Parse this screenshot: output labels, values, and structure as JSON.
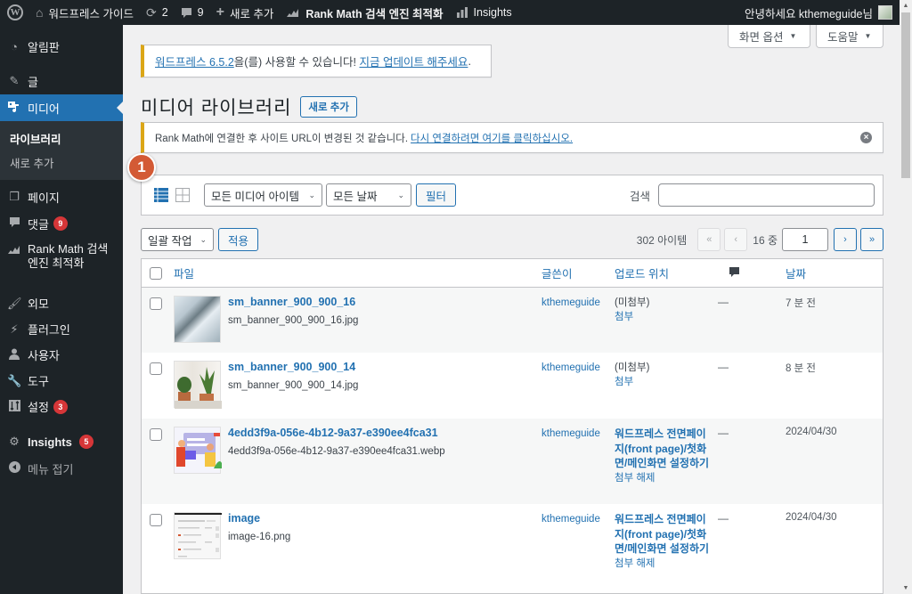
{
  "admin_bar": {
    "wp_logo": "W",
    "site_name": "워드프레스 가이드",
    "updates_count": "2",
    "comments_count": "9",
    "new_label": "새로 추가",
    "rankmath_label": "Rank Math 검색 엔진 최적화",
    "insights_label": "Insights",
    "greeting": "안녕하세요 kthemeguide님"
  },
  "sidebar": {
    "items": [
      {
        "label": "알림판",
        "icon": "dashboard-icon"
      },
      {
        "label": "글",
        "icon": "pin-icon"
      },
      {
        "label": "미디어",
        "icon": "media-icon",
        "current": true
      },
      {
        "label": "페이지",
        "icon": "pages-icon"
      },
      {
        "label": "댓글",
        "icon": "comments-icon",
        "badge": "9"
      },
      {
        "label": "Rank Math 검색 엔진 최적화",
        "label_line1": "Rank Math 검색",
        "label_line2": "엔진 최적화",
        "icon": "rankmath-icon"
      },
      {
        "label": "외모",
        "icon": "appearance-icon"
      },
      {
        "label": "플러그인",
        "icon": "plugins-icon"
      },
      {
        "label": "사용자",
        "icon": "users-icon"
      },
      {
        "label": "도구",
        "icon": "tools-icon"
      },
      {
        "label": "설정",
        "icon": "settings-icon",
        "badge": "3"
      },
      {
        "label": "Insights",
        "icon": "insights-icon",
        "badge": "5"
      },
      {
        "label": "메뉴 접기",
        "icon": "collapse-icon"
      }
    ],
    "submenu": {
      "library": "라이브러리",
      "add_new": "새로 추가"
    }
  },
  "screen_meta": {
    "screen_options": "화면 옵션",
    "help": "도움말"
  },
  "update_notice": {
    "link1": "워드프레스 6.5.2",
    "text": "을(를) 사용할 수 있습니다! ",
    "link2": "지금 업데이트 해주세요",
    "end": "."
  },
  "page": {
    "title": "미디어 라이브러리",
    "add_new": "새로 추가"
  },
  "rankmath_notice": {
    "text": "Rank Math에 연결한 후 사이트 URL이 변경된 것 같습니다.",
    "link": "다시 연결하려면 여기를 클릭하십시오."
  },
  "annotation": {
    "step": "1"
  },
  "filter_bar": {
    "media_type": "모든 미디어 아이템",
    "date": "모든 날짜",
    "filter_button": "필터",
    "search_label": "검색",
    "search_value": ""
  },
  "tablenav": {
    "bulk_action": "일괄 작업",
    "apply": "적용",
    "item_count": "302 아이템",
    "first": "«",
    "prev": "‹",
    "total_pages_label": "16 중",
    "current_page": "1",
    "next": "›",
    "last": "»"
  },
  "table": {
    "columns": {
      "file": "파일",
      "author": "글쓴이",
      "uploaded_to": "업로드 위치",
      "comments_icon": "comment-icon",
      "date": "날짜"
    },
    "rows": [
      {
        "title": "sm_banner_900_900_16",
        "filename": "sm_banner_900_900_16.jpg",
        "author": "kthemeguide",
        "parent": "(미첨부)",
        "parent_action": "첨부",
        "comments": "—",
        "date": "7 분 전"
      },
      {
        "title": "sm_banner_900_900_14",
        "filename": "sm_banner_900_900_14.jpg",
        "author": "kthemeguide",
        "parent": "(미첨부)",
        "parent_action": "첨부",
        "comments": "—",
        "date": "8 분 전"
      },
      {
        "title": "4edd3f9a-056e-4b12-9a37-e390ee4fca31",
        "filename": "4edd3f9a-056e-4b12-9a37-e390ee4fca31.webp",
        "author": "kthemeguide",
        "parent": "워드프레스 전면페이지(front page)/첫화면/메인화면 설정하기",
        "parent_action": "첨부 해제",
        "comments": "—",
        "date": "2024/04/30"
      },
      {
        "title": "image",
        "filename": "image-16.png",
        "author": "kthemeguide",
        "parent": "워드프레스 전면페이지(front page)/첫화면/메인화면 설정하기",
        "parent_action": "첨부 해제",
        "comments": "—",
        "date": "2024/04/30"
      }
    ]
  },
  "colors": {
    "admin_dark": "#1d2327",
    "accent": "#2271b1",
    "badge": "#d63638",
    "warning_border": "#dba617",
    "annotation": "#d35a35"
  }
}
